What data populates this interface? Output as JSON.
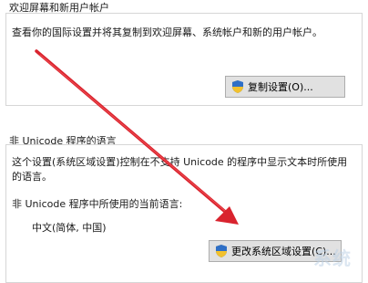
{
  "welcome_section": {
    "title": "欢迎屏幕和新用户帐户",
    "description": "查看你的国际设置并将其复制到欢迎屏幕、系统帐户和新的用户帐户。",
    "copy_button_label": "复制设置(O)..."
  },
  "unicode_section": {
    "title": "非 Unicode 程序的语言",
    "description_line1": "这个设置(系统区域设置)控制在不支持 Unicode 的程序中显示文本时所使用",
    "description_line2": "的语言。",
    "current_label": "非 Unicode 程序中所使用的当前语言:",
    "current_value": "中文(简体, 中国)",
    "change_button_label": "更改系统区域设置(C)..."
  },
  "icons": {
    "shield": "shield-icon"
  },
  "colors": {
    "annotation_arrow": "#d9232e",
    "shield_blue": "#2f6fc6",
    "shield_yellow": "#f2c12e"
  }
}
